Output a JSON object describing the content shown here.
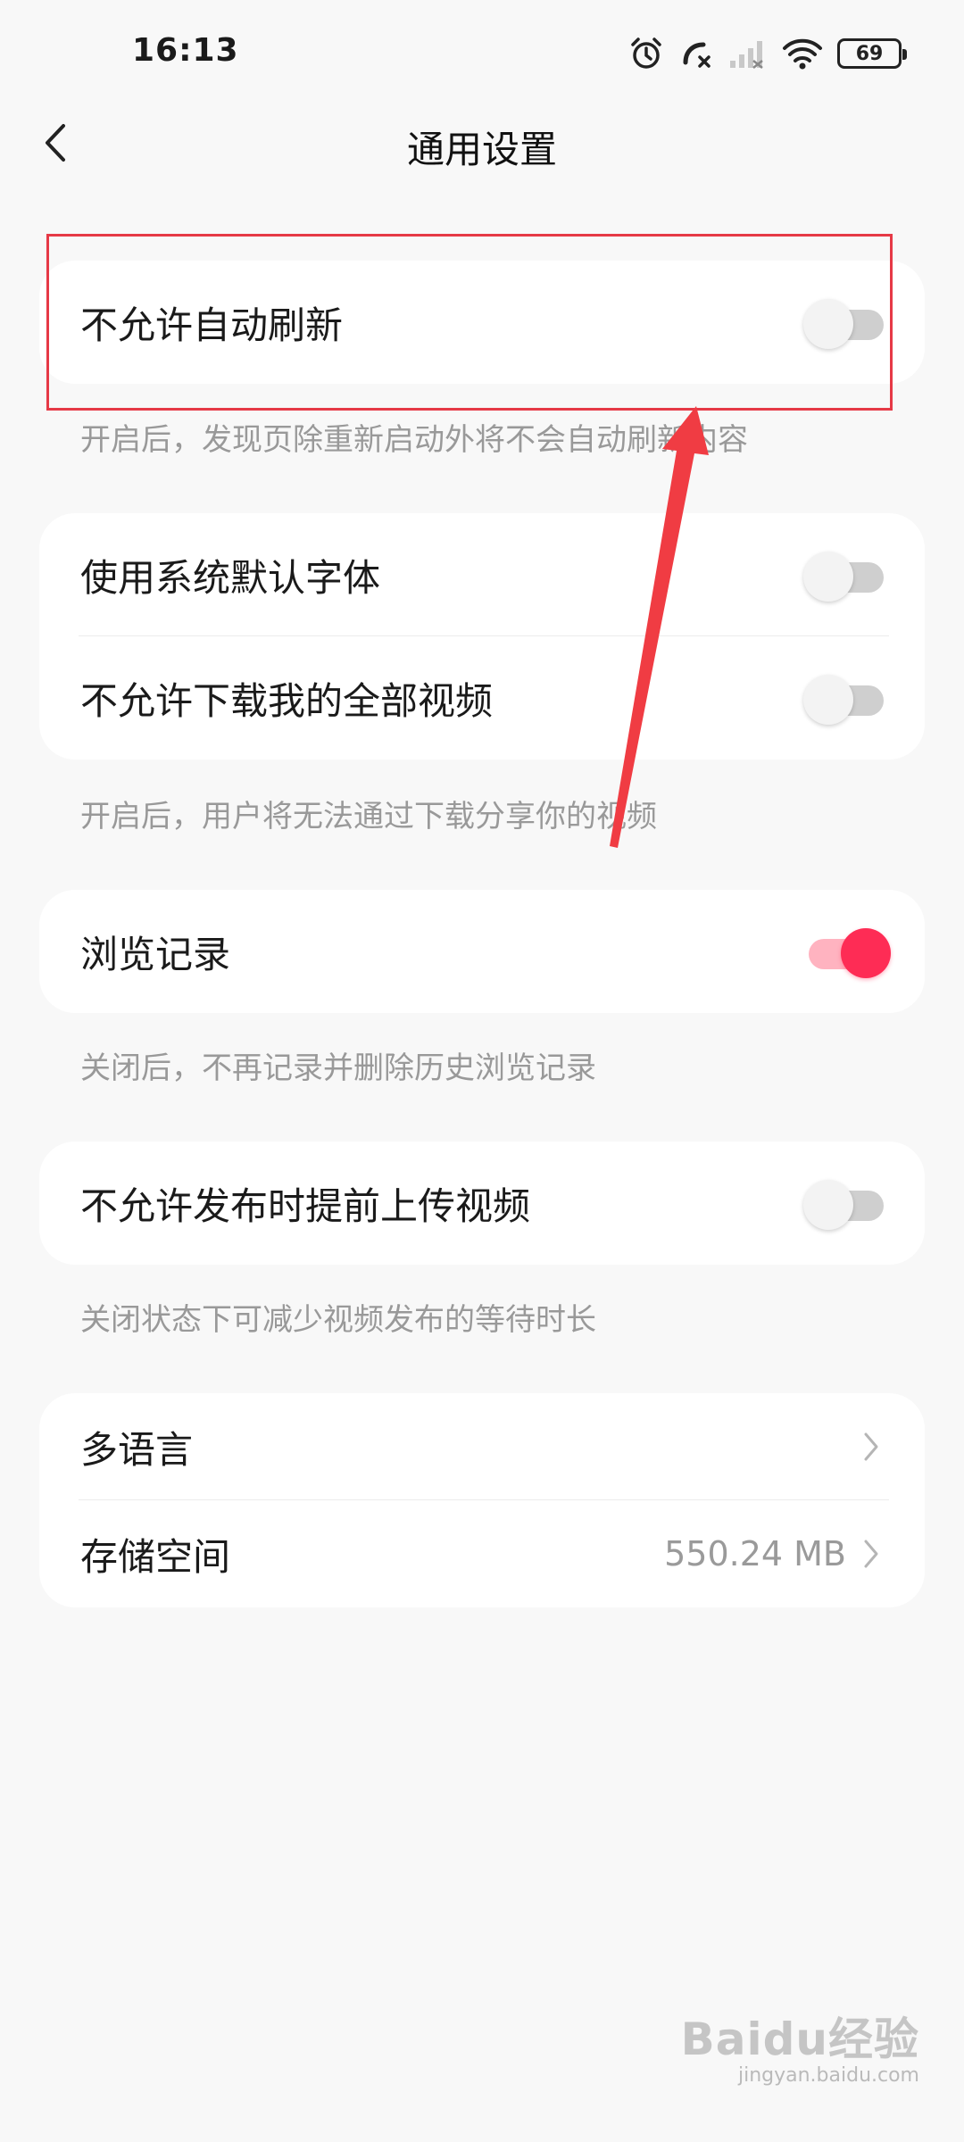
{
  "status_bar": {
    "time": "16:13",
    "battery_level": "69",
    "icons": [
      "alarm-icon",
      "missed-call-icon",
      "signal-icon",
      "wifi-icon",
      "battery-icon"
    ]
  },
  "header": {
    "title": "通用设置",
    "back_icon": "chevron-left-icon"
  },
  "sections": {
    "auto_refresh": {
      "label": "不允许自动刷新",
      "enabled": false,
      "hint": "开启后，发现页除重新启动外将不会自动刷新内容"
    },
    "font_and_download": {
      "font_label": "使用系统默认字体",
      "font_enabled": false,
      "download_label": "不允许下载我的全部视频",
      "download_enabled": false,
      "hint": "开启后，用户将无法通过下载分享你的视频"
    },
    "history": {
      "label": "浏览记录",
      "enabled": true,
      "hint": "关闭后，不再记录并删除历史浏览记录"
    },
    "preupload": {
      "label": "不允许发布时提前上传视频",
      "enabled": false,
      "hint": "关闭状态下可减少视频发布的等待时长"
    },
    "misc": {
      "language_label": "多语言",
      "storage_label": "存储空间",
      "storage_value": "550.24 MB"
    }
  },
  "colors": {
    "accent": "#fe2c55",
    "accent_track": "#ffb3c0",
    "annotation": "#e63946",
    "background": "#f8f8f8",
    "hint_text": "#999999"
  },
  "watermark": {
    "logo": "Baidu经验",
    "site": "jingyan.baidu.com"
  }
}
